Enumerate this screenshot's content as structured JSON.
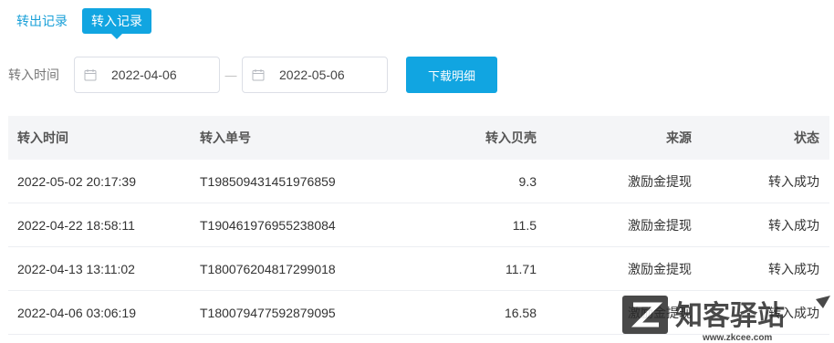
{
  "tabs": [
    {
      "label": "转出记录",
      "active": false
    },
    {
      "label": "转入记录",
      "active": true
    }
  ],
  "filter": {
    "label": "转入时间",
    "start_date": "2022-04-06",
    "separator": "—",
    "end_date": "2022-05-06",
    "download_label": "下载明细"
  },
  "table": {
    "headers": [
      "转入时间",
      "转入单号",
      "转入贝壳",
      "来源",
      "状态"
    ],
    "rows": [
      [
        "2022-05-02 20:17:39",
        "T198509431451976859",
        "9.3",
        "激励金提现",
        "转入成功"
      ],
      [
        "2022-04-22 18:58:11",
        "T190461976955238084",
        "11.5",
        "激励金提现",
        "转入成功"
      ],
      [
        "2022-04-13 13:11:02",
        "T180076204817299018",
        "11.71",
        "激励金提现",
        "转入成功"
      ],
      [
        "2022-04-06 03:06:19",
        "T180079477592879095",
        "16.58",
        "激励金提现",
        "转入成功"
      ]
    ]
  },
  "watermark": {
    "brand": "知客驿站",
    "url": "www.zkcee.com"
  },
  "colors": {
    "accent": "#11a5e1",
    "header_bg": "#f4f5f7"
  }
}
